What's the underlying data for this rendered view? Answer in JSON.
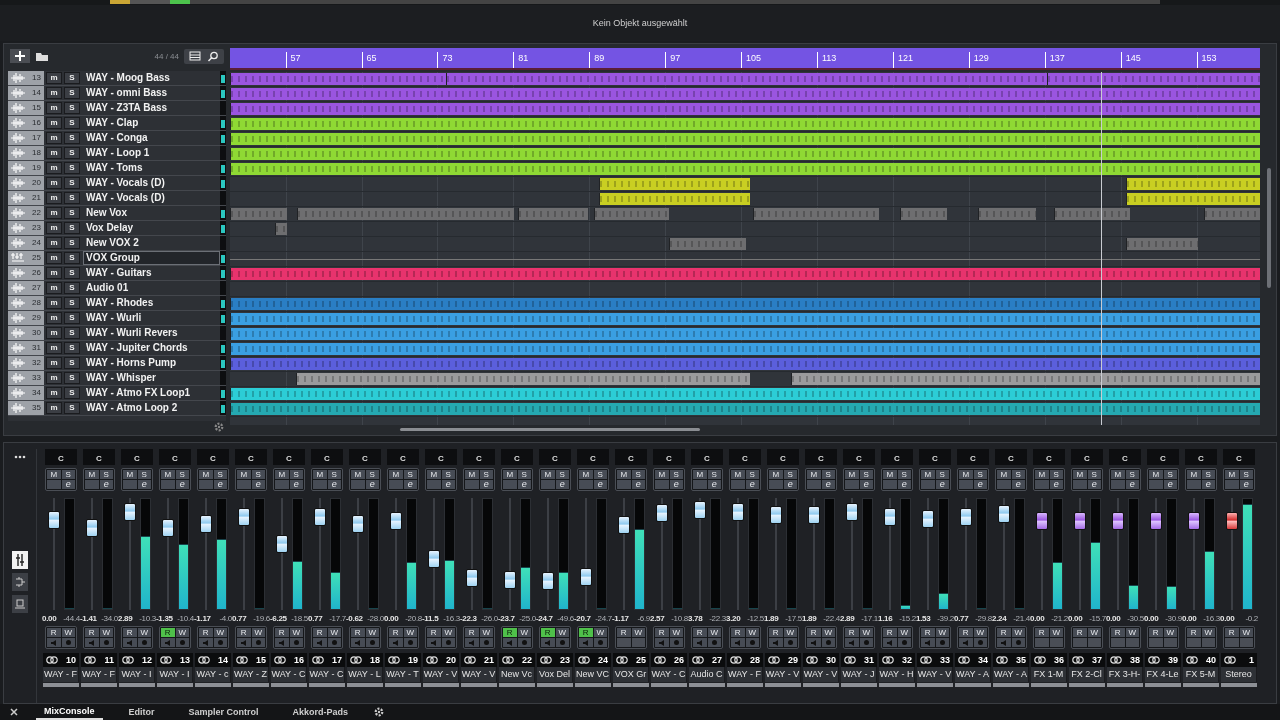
{
  "info_line": "Kein Objekt ausgewählt",
  "track_header": {
    "count": "44 / 44"
  },
  "ruler": [
    "57",
    "65",
    "73",
    "81",
    "89",
    "97",
    "105",
    "113",
    "121",
    "129",
    "137",
    "145",
    "153"
  ],
  "tracks": [
    {
      "number": "13",
      "name": "WAY - Moog Bass",
      "kind": "audio",
      "m": "m",
      "s": "S",
      "selected": false,
      "color": "#9a55e0"
    },
    {
      "number": "14",
      "name": "WAY - omni Bass",
      "kind": "audio",
      "m": "m",
      "s": "S",
      "selected": false,
      "color": "#9a55e0"
    },
    {
      "number": "15",
      "name": "WAY - Z3TA Bass",
      "kind": "audio",
      "m": "m",
      "s": "S",
      "selected": false,
      "color": "#9a55e0"
    },
    {
      "number": "16",
      "name": "WAY - Clap",
      "kind": "audio",
      "m": "m",
      "s": "S",
      "selected": false,
      "color": "#8fd934"
    },
    {
      "number": "17",
      "name": "WAY - Conga",
      "kind": "audio",
      "m": "m",
      "s": "S",
      "selected": false,
      "color": "#8fd934"
    },
    {
      "number": "18",
      "name": "WAY - Loop 1",
      "kind": "audio",
      "m": "m",
      "s": "S",
      "selected": false,
      "color": "#8fd934"
    },
    {
      "number": "19",
      "name": "WAY - Toms",
      "kind": "audio",
      "m": "m",
      "s": "S",
      "selected": false,
      "color": "#8fd934"
    },
    {
      "number": "20",
      "name": "WAY - Vocals (D)",
      "kind": "audio",
      "m": "m",
      "s": "S",
      "selected": false,
      "color": "#c9cf22"
    },
    {
      "number": "21",
      "name": "WAY - Vocals (D)",
      "kind": "audio",
      "m": "m",
      "s": "S",
      "selected": false,
      "color": "#c9cf22"
    },
    {
      "number": "22",
      "name": "New Vox",
      "kind": "audio",
      "m": "m",
      "s": "S",
      "selected": false,
      "color": "#6e6e70"
    },
    {
      "number": "23",
      "name": "Vox Delay",
      "kind": "audio",
      "m": "m",
      "s": "S",
      "selected": false,
      "color": "#6e6e70"
    },
    {
      "number": "24",
      "name": "New VOX 2",
      "kind": "audio",
      "m": "m",
      "s": "S",
      "selected": false,
      "color": "#6e6e70"
    },
    {
      "number": "25",
      "name": "VOX Group",
      "kind": "group",
      "m": "m",
      "s": "S",
      "selected": true
    },
    {
      "number": "26",
      "name": "WAY - Guitars",
      "kind": "audio",
      "m": "m",
      "s": "S",
      "selected": false,
      "color": "#e8336d"
    },
    {
      "number": "27",
      "name": "Audio 01",
      "kind": "audio",
      "m": "m",
      "s": "S",
      "selected": false
    },
    {
      "number": "28",
      "name": "WAY - Rhodes",
      "kind": "audio",
      "m": "m",
      "s": "S",
      "selected": false,
      "color": "#2a7ec4"
    },
    {
      "number": "29",
      "name": "WAY - Wurli",
      "kind": "audio",
      "m": "m",
      "s": "S",
      "selected": false,
      "color": "#3a9fe2"
    },
    {
      "number": "30",
      "name": "WAY - Wurli Revers",
      "kind": "audio",
      "m": "m",
      "s": "S",
      "selected": false,
      "color": "#3a9fe2"
    },
    {
      "number": "31",
      "name": "WAY - Jupiter Chords",
      "kind": "audio",
      "m": "m",
      "s": "S",
      "selected": false,
      "color": "#3a9fe2"
    },
    {
      "number": "32",
      "name": "WAY - Horns Pump",
      "kind": "audio",
      "m": "m",
      "s": "S",
      "selected": false,
      "color": "#5b5fdc"
    },
    {
      "number": "33",
      "name": "WAY - Whisper",
      "kind": "audio",
      "m": "m",
      "s": "S",
      "selected": false,
      "color": "#9a9a9c"
    },
    {
      "number": "34",
      "name": "WAY - Atmo FX Loop1",
      "kind": "audio",
      "m": "m",
      "s": "S",
      "selected": false,
      "color": "#2ccdd6"
    },
    {
      "number": "35",
      "name": "WAY - Atmo Loop 2",
      "kind": "audio",
      "m": "m",
      "s": "S",
      "selected": false,
      "color": "#25a9b2"
    }
  ],
  "channels": [
    {
      "number": "10",
      "name": "WAY - F",
      "kind": "audio",
      "pan": "C",
      "buttons": [
        "M",
        "S",
        "e"
      ],
      "auto": [
        "R",
        "W"
      ],
      "read": false,
      "volume": "0.00",
      "peak": "-44.4",
      "fader": {
        "level": 0.81
      },
      "meter": {
        "level": 0
      }
    },
    {
      "number": "11",
      "name": "WAY - F",
      "kind": "audio",
      "pan": "C",
      "buttons": [
        "M",
        "S",
        "e"
      ],
      "auto": [
        "R",
        "W"
      ],
      "read": false,
      "volume": "-1.41",
      "peak": "-34.0",
      "fader": {
        "level": 0.74
      },
      "meter": {
        "level": 0
      }
    },
    {
      "number": "12",
      "name": "WAY - I",
      "kind": "audio",
      "pan": "C",
      "buttons": [
        "M",
        "S",
        "e"
      ],
      "auto": [
        "R",
        "W"
      ],
      "read": false,
      "volume": "2.89",
      "peak": "-10.3",
      "fader": {
        "level": 0.88
      },
      "meter": {
        "level": 0.66
      }
    },
    {
      "number": "13",
      "name": "WAY - I",
      "kind": "audio",
      "pan": "C",
      "buttons": [
        "M",
        "S",
        "e"
      ],
      "auto": [
        "R",
        "W"
      ],
      "read": true,
      "volume": "-1.35",
      "peak": "-10.4",
      "fader": {
        "level": 0.74
      },
      "meter": {
        "level": 0.59
      }
    },
    {
      "number": "14",
      "name": "WAY - c",
      "kind": "audio",
      "pan": "C",
      "buttons": [
        "M",
        "S",
        "e"
      ],
      "auto": [
        "R",
        "W"
      ],
      "read": false,
      "volume": "-1.17",
      "peak": "-4.0",
      "fader": {
        "level": 0.77
      },
      "meter": {
        "level": 0.63
      }
    },
    {
      "number": "15",
      "name": "WAY - Z",
      "kind": "audio",
      "pan": "C",
      "buttons": [
        "M",
        "S",
        "e"
      ],
      "auto": [
        "R",
        "W"
      ],
      "read": false,
      "volume": "0.77",
      "peak": "-19.6",
      "fader": {
        "level": 0.83
      },
      "meter": {
        "level": 0
      }
    },
    {
      "number": "16",
      "name": "WAY - C",
      "kind": "audio",
      "pan": "C",
      "buttons": [
        "M",
        "S",
        "e"
      ],
      "auto": [
        "R",
        "W"
      ],
      "read": false,
      "volume": "-6.25",
      "peak": "-18.5",
      "fader": {
        "level": 0.59
      },
      "meter": {
        "level": 0.43
      }
    },
    {
      "number": "17",
      "name": "WAY - C",
      "kind": "audio",
      "pan": "C",
      "buttons": [
        "M",
        "S",
        "e"
      ],
      "auto": [
        "R",
        "W"
      ],
      "read": false,
      "volume": "0.77",
      "peak": "-17.7",
      "fader": {
        "level": 0.83
      },
      "meter": {
        "level": 0.33
      }
    },
    {
      "number": "18",
      "name": "WAY - L",
      "kind": "audio",
      "pan": "C",
      "buttons": [
        "M",
        "S",
        "e"
      ],
      "auto": [
        "R",
        "W"
      ],
      "read": false,
      "volume": "-0.62",
      "peak": "-28.0",
      "fader": {
        "level": 0.77
      },
      "meter": {
        "level": 0
      }
    },
    {
      "number": "19",
      "name": "WAY - T",
      "kind": "audio",
      "pan": "C",
      "buttons": [
        "M",
        "S",
        "e"
      ],
      "auto": [
        "R",
        "W"
      ],
      "read": false,
      "volume": "0.00",
      "peak": "-20.8",
      "fader": {
        "level": 0.8
      },
      "meter": {
        "level": 0.42
      }
    },
    {
      "number": "20",
      "name": "WAY - V",
      "kind": "audio",
      "pan": "C",
      "buttons": [
        "M",
        "S",
        "e"
      ],
      "auto": [
        "R",
        "W"
      ],
      "read": false,
      "volume": "-11.5",
      "peak": "-16.3",
      "fader": {
        "level": 0.46
      },
      "meter": {
        "level": 0.44
      }
    },
    {
      "number": "21",
      "name": "WAY - V",
      "kind": "audio",
      "pan": "C",
      "buttons": [
        "M",
        "S",
        "e"
      ],
      "auto": [
        "R",
        "W"
      ],
      "read": false,
      "volume": "-22.3",
      "peak": "-26.0",
      "fader": {
        "level": 0.29
      },
      "meter": {
        "level": 0
      }
    },
    {
      "number": "22",
      "name": "New Vc",
      "kind": "audio",
      "pan": "C",
      "buttons": [
        "M",
        "S",
        "e"
      ],
      "auto": [
        "R",
        "W"
      ],
      "read": true,
      "volume": "-23.7",
      "peak": "-25.0",
      "fader": {
        "level": 0.27
      },
      "meter": {
        "level": 0.38
      }
    },
    {
      "number": "23",
      "name": "Vox Del",
      "kind": "audio",
      "pan": "C",
      "buttons": [
        "M",
        "S",
        "e"
      ],
      "auto": [
        "R",
        "W"
      ],
      "read": true,
      "volume": "-24.7",
      "peak": "-49.6",
      "fader": {
        "level": 0.26
      },
      "meter": {
        "level": 0.33
      }
    },
    {
      "number": "24",
      "name": "New VC",
      "kind": "audio",
      "pan": "C",
      "buttons": [
        "M",
        "S",
        "e"
      ],
      "auto": [
        "R",
        "W"
      ],
      "read": true,
      "volume": "-20.7",
      "peak": "-24.7",
      "fader": {
        "level": 0.3
      },
      "meter": {
        "level": 0
      }
    },
    {
      "number": "25",
      "name": "VOX Gr",
      "kind": "group",
      "pan": "C",
      "buttons": [
        "M",
        "S",
        "e"
      ],
      "auto": [
        "R",
        "W"
      ],
      "read": false,
      "volume": "-1.17",
      "peak": "-6.9",
      "fader": {
        "level": 0.76
      },
      "meter": {
        "level": 0.72
      }
    },
    {
      "number": "26",
      "name": "WAY - C",
      "kind": "audio",
      "pan": "C",
      "buttons": [
        "M",
        "S",
        "e"
      ],
      "auto": [
        "R",
        "W"
      ],
      "read": false,
      "volume": "2.57",
      "peak": "-10.8",
      "fader": {
        "level": 0.87
      },
      "meter": {
        "level": 0
      }
    },
    {
      "number": "27",
      "name": "Audio C",
      "kind": "audio",
      "pan": "C",
      "buttons": [
        "M",
        "S",
        "e"
      ],
      "auto": [
        "R",
        "W"
      ],
      "read": false,
      "volume": "3.78",
      "peak": "-22.3",
      "fader": {
        "level": 0.9
      },
      "meter": {
        "level": 0
      }
    },
    {
      "number": "28",
      "name": "WAY - F",
      "kind": "audio",
      "pan": "C",
      "buttons": [
        "M",
        "S",
        "e"
      ],
      "auto": [
        "R",
        "W"
      ],
      "read": false,
      "volume": "3.20",
      "peak": "-12.5",
      "fader": {
        "level": 0.88
      },
      "meter": {
        "level": 0
      }
    },
    {
      "number": "29",
      "name": "WAY - V",
      "kind": "audio",
      "pan": "C",
      "buttons": [
        "M",
        "S",
        "e"
      ],
      "auto": [
        "R",
        "W"
      ],
      "read": false,
      "volume": "1.89",
      "peak": "-17.5",
      "fader": {
        "level": 0.85
      },
      "meter": {
        "level": 0
      }
    },
    {
      "number": "30",
      "name": "WAY - V",
      "kind": "audio",
      "pan": "C",
      "buttons": [
        "M",
        "S",
        "e"
      ],
      "auto": [
        "R",
        "W"
      ],
      "read": false,
      "volume": "1.89",
      "peak": "-22.4",
      "fader": {
        "level": 0.85
      },
      "meter": {
        "level": 0
      }
    },
    {
      "number": "31",
      "name": "WAY - J",
      "kind": "audio",
      "pan": "C",
      "buttons": [
        "M",
        "S",
        "e"
      ],
      "auto": [
        "R",
        "W"
      ],
      "read": false,
      "volume": "2.89",
      "peak": "-17.1",
      "fader": {
        "level": 0.88
      },
      "meter": {
        "level": 0
      }
    },
    {
      "number": "32",
      "name": "WAY - H",
      "kind": "audio",
      "pan": "C",
      "buttons": [
        "M",
        "S",
        "e"
      ],
      "auto": [
        "R",
        "W"
      ],
      "read": false,
      "volume": "1.16",
      "peak": "-15.2",
      "fader": {
        "level": 0.83
      },
      "meter": {
        "level": 0.03
      }
    },
    {
      "number": "33",
      "name": "WAY - V",
      "kind": "audio",
      "pan": "C",
      "buttons": [
        "M",
        "S",
        "e"
      ],
      "auto": [
        "R",
        "W"
      ],
      "read": false,
      "volume": "1.53",
      "peak": "-39.2",
      "fader": {
        "level": 0.82
      },
      "meter": {
        "level": 0.14
      }
    },
    {
      "number": "34",
      "name": "WAY - A",
      "kind": "audio",
      "pan": "C",
      "buttons": [
        "M",
        "S",
        "e"
      ],
      "auto": [
        "R",
        "W"
      ],
      "read": false,
      "volume": "0.77",
      "peak": "-29.8",
      "fader": {
        "level": 0.83
      },
      "meter": {
        "level": 0
      }
    },
    {
      "number": "35",
      "name": "WAY - A",
      "kind": "audio",
      "pan": "C",
      "buttons": [
        "M",
        "S",
        "e"
      ],
      "auto": [
        "R",
        "W"
      ],
      "read": false,
      "volume": "2.24",
      "peak": "-21.4",
      "fader": {
        "level": 0.86
      },
      "meter": {
        "level": 0
      }
    },
    {
      "number": "36",
      "name": "FX 1-M",
      "kind": "fx",
      "pan": "C",
      "buttons": [
        "M",
        "S",
        "e"
      ],
      "auto": [
        "R",
        "W"
      ],
      "read": false,
      "volume": "0.00",
      "peak": "-21.2",
      "fader": {
        "level": 0.8
      },
      "meter": {
        "level": 0.42
      }
    },
    {
      "number": "37",
      "name": "FX 2-Cl",
      "kind": "fx",
      "pan": "C",
      "buttons": [
        "M",
        "S",
        "e"
      ],
      "auto": [
        "R",
        "W"
      ],
      "read": false,
      "volume": "0.00",
      "peak": "-15.7",
      "fader": {
        "level": 0.8
      },
      "meter": {
        "level": 0.6
      }
    },
    {
      "number": "38",
      "name": "FX 3-H-",
      "kind": "fx",
      "pan": "C",
      "buttons": [
        "M",
        "S",
        "e"
      ],
      "auto": [
        "R",
        "W"
      ],
      "read": false,
      "volume": "0.00",
      "peak": "-30.5",
      "fader": {
        "level": 0.8
      },
      "meter": {
        "level": 0.21
      }
    },
    {
      "number": "39",
      "name": "FX 4-Le",
      "kind": "fx",
      "pan": "C",
      "buttons": [
        "M",
        "S",
        "e"
      ],
      "auto": [
        "R",
        "W"
      ],
      "read": false,
      "volume": "0.00",
      "peak": "-30.9",
      "fader": {
        "level": 0.8
      },
      "meter": {
        "level": 0.2
      }
    },
    {
      "number": "40",
      "name": "FX 5-M",
      "kind": "fx",
      "pan": "C",
      "buttons": [
        "M",
        "S",
        "e"
      ],
      "auto": [
        "R",
        "W"
      ],
      "read": false,
      "volume": "0.00",
      "peak": "-16.3",
      "fader": {
        "level": 0.8
      },
      "meter": {
        "level": 0.52
      }
    },
    {
      "number": "1",
      "name": "Stereo",
      "kind": "output",
      "pan": "C",
      "buttons": [
        "M",
        "S",
        "e"
      ],
      "auto": [
        "R",
        "W"
      ],
      "read": false,
      "volume": "0.00",
      "peak": "-0.2",
      "fader": {
        "level": 0.8
      },
      "meter": {
        "level": 0.95
      }
    }
  ],
  "tabs": [
    {
      "label": "MixConsole",
      "selected": true
    },
    {
      "label": "Editor",
      "selected": false
    },
    {
      "label": "Sampler Control",
      "selected": false
    },
    {
      "label": "Akkord-Pads",
      "selected": false
    }
  ]
}
